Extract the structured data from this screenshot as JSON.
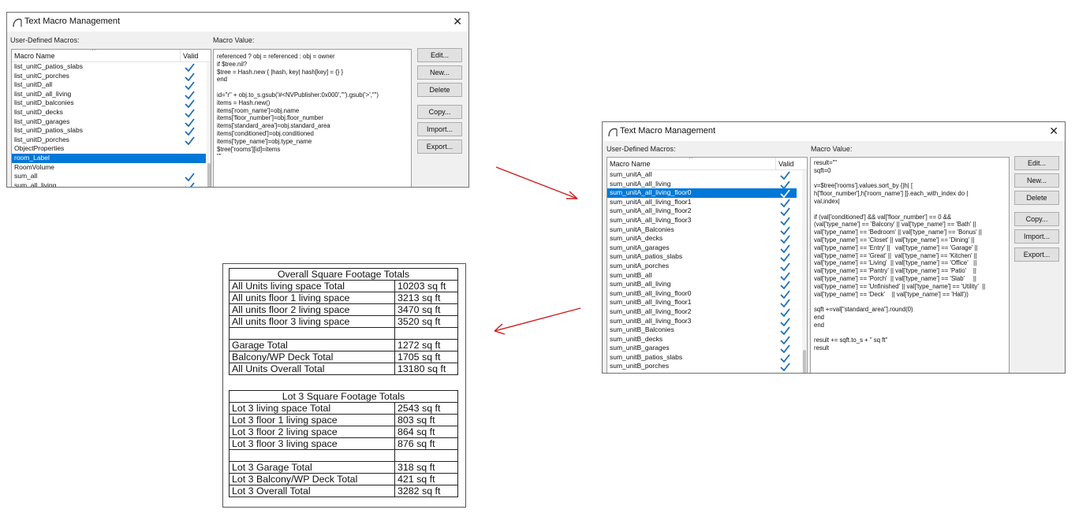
{
  "dialog1": {
    "title": "Text Macro Management",
    "macros_label": "User-Defined Macros:",
    "value_label": "Macro Value:",
    "col_name": "Macro Name",
    "col_valid": "Valid",
    "close_glyph": "✕",
    "macros": [
      {
        "name": "list_unitC_patios_slabs",
        "valid": true,
        "selected": false
      },
      {
        "name": "list_unitC_porches",
        "valid": true,
        "selected": false
      },
      {
        "name": "list_unitD_all",
        "valid": true,
        "selected": false
      },
      {
        "name": "list_unitD_all_living",
        "valid": true,
        "selected": false
      },
      {
        "name": "list_unitD_balconies",
        "valid": true,
        "selected": false
      },
      {
        "name": "list_unitD_decks",
        "valid": true,
        "selected": false
      },
      {
        "name": "list_unitD_garages",
        "valid": true,
        "selected": false
      },
      {
        "name": "list_unitD_patios_slabs",
        "valid": true,
        "selected": false
      },
      {
        "name": "list_unitD_porches",
        "valid": true,
        "selected": false
      },
      {
        "name": "ObjectProperties",
        "valid": false,
        "selected": false
      },
      {
        "name": "room_Label",
        "valid": false,
        "selected": true
      },
      {
        "name": "RoomVolume",
        "valid": false,
        "selected": false
      },
      {
        "name": "sum_all",
        "valid": true,
        "selected": false
      },
      {
        "name": "sum_all_living",
        "valid": true,
        "selected": false
      }
    ],
    "code": [
      "referenced ? obj = referenced : obj = owner",
      "if $tree.nil?",
      "$tree = Hash.new { |hash, key| hash[key] = {} }",
      "end",
      "",
      "id=\"r\" + obj.to_s.gsub('#<NVPublisher:0x000',\"\").gsub('>',\"\")",
      "items = Hash.new()",
      "items['room_name']=obj.name",
      "items['floor_number']=obj.floor_number",
      "items['standard_area']=obj.standard_area",
      "items['conditioned']=obj.conditioned",
      "items['type_name']=obj.type_name",
      "$tree['rooms'][id]=items",
      "\"\""
    ],
    "buttons": {
      "edit": "Edit...",
      "new": "New...",
      "delete": "Delete",
      "copy": "Copy...",
      "import": "Import...",
      "export": "Export..."
    }
  },
  "dialog2": {
    "title": "Text Macro Management",
    "macros_label": "User-Defined Macros:",
    "value_label": "Macro Value:",
    "col_name": "Macro Name",
    "col_valid": "Valid",
    "close_glyph": "✕",
    "macros": [
      {
        "name": "sum_unitA_all",
        "valid": true,
        "selected": false
      },
      {
        "name": "sum_unitA_all_living",
        "valid": true,
        "selected": false
      },
      {
        "name": "sum_unitA_all_living_floor0",
        "valid": true,
        "selected": true
      },
      {
        "name": "sum_unitA_all_living_floor1",
        "valid": true,
        "selected": false
      },
      {
        "name": "sum_unitA_all_living_floor2",
        "valid": true,
        "selected": false
      },
      {
        "name": "sum_unitA_all_living_floor3",
        "valid": true,
        "selected": false
      },
      {
        "name": "sum_unitA_Balconies",
        "valid": true,
        "selected": false
      },
      {
        "name": "sum_unitA_decks",
        "valid": true,
        "selected": false
      },
      {
        "name": "sum_unitA_garages",
        "valid": true,
        "selected": false
      },
      {
        "name": "sum_unitA_patios_slabs",
        "valid": true,
        "selected": false
      },
      {
        "name": "sum_unitA_porches",
        "valid": true,
        "selected": false
      },
      {
        "name": "sum_unitB_all",
        "valid": true,
        "selected": false
      },
      {
        "name": "sum_unitB_all_living",
        "valid": true,
        "selected": false
      },
      {
        "name": "sum_unitB_all_living_floor0",
        "valid": true,
        "selected": false
      },
      {
        "name": "sum_unitB_all_living_floor1",
        "valid": true,
        "selected": false
      },
      {
        "name": "sum_unitB_all_living_floor2",
        "valid": true,
        "selected": false
      },
      {
        "name": "sum_unitB_all_living_floor3",
        "valid": true,
        "selected": false
      },
      {
        "name": "sum_unitB_Balconies",
        "valid": true,
        "selected": false
      },
      {
        "name": "sum_unitB_decks",
        "valid": true,
        "selected": false
      },
      {
        "name": "sum_unitB_garages",
        "valid": true,
        "selected": false
      },
      {
        "name": "sum_unitB_patios_slabs",
        "valid": true,
        "selected": false
      },
      {
        "name": "sum_unitB_porches",
        "valid": true,
        "selected": false
      }
    ],
    "code": [
      "result=\"\"",
      "sqft=0",
      "",
      "v=$tree['rooms'].values.sort_by {|h| [",
      "h['floor_number'],h['room_name'] ]}.each_with_index do |",
      "val,index|",
      "",
      "if (val['conditioned'] && val['floor_number'] == 0 &&",
      "(val['type_name'] == 'Balcony' || val['type_name'] == 'Bath' ||",
      "val['type_name'] == 'Bedroom' || val['type_name'] == 'Bonus' ||",
      "val['type_name'] == 'Closet' || val['type_name'] == 'Dining' ||",
      "val['type_name'] == 'Entry' ||   val['type_name'] == 'Garage' ||",
      "val['type_name'] == 'Great' ||  val['type_name'] == 'Kitchen' ||",
      "val['type_name'] == 'Living'  || val['type_name'] == 'Office'   ||",
      "val['type_name'] == 'Pantry' || val['type_name'] == 'Patio'    ||",
      "val['type_name'] == 'Porch'  || val['type_name'] == 'Slab'     ||",
      "val['type_name'] == 'Unfinished' || val['type_name'] == 'Utility'  ||",
      "val['type_name'] == 'Deck'    || val['type_name'] == 'Hall'))",
      "",
      "sqft +=val[\"standard_area\"].round(0)",
      "end",
      "end",
      "",
      "result += sqft.to_s + \" sq ft\"",
      "result"
    ],
    "buttons": {
      "edit": "Edit...",
      "new": "New...",
      "delete": "Delete",
      "copy": "Copy...",
      "import": "Import...",
      "export": "Export..."
    }
  },
  "overall_table": {
    "title": "Overall Square Footage Totals",
    "rows": [
      {
        "label": "All Units living space Total",
        "value": "10203 sq ft"
      },
      {
        "label": "All units floor 1 living space",
        "value": "3213 sq ft"
      },
      {
        "label": "All units floor 2 living space",
        "value": "3470 sq ft"
      },
      {
        "label": "All units floor 3 living space",
        "value": "3520 sq ft"
      },
      {
        "label": "",
        "value": ""
      },
      {
        "label": "Garage Total",
        "value": "1272 sq ft"
      },
      {
        "label": "Balcony/WP Deck Total",
        "value": "1705 sq ft"
      },
      {
        "label": "All Units Overall Total",
        "value": "13180 sq ft"
      }
    ]
  },
  "lot_table": {
    "title": "Lot 3 Square Footage Totals",
    "rows": [
      {
        "label": "Lot 3 living space Total",
        "value": "2543 sq ft"
      },
      {
        "label": "Lot 3 floor 1 living space",
        "value": "803 sq ft"
      },
      {
        "label": "Lot 3 floor 2 living space",
        "value": "864 sq ft"
      },
      {
        "label": "Lot 3 floor 3 living space",
        "value": "876 sq ft"
      },
      {
        "label": "",
        "value": ""
      },
      {
        "label": "Lot 3 Garage Total",
        "value": "318 sq ft"
      },
      {
        "label": "Lot 3 Balcony/WP Deck Total",
        "value": "421 sq ft"
      },
      {
        "label": "Lot 3 Overall Total",
        "value": "3282 sq ft"
      }
    ]
  },
  "colors": {
    "selection": "#0078d7",
    "checkmark": "#1e6fb8",
    "arrow": "#cc1f1f"
  }
}
